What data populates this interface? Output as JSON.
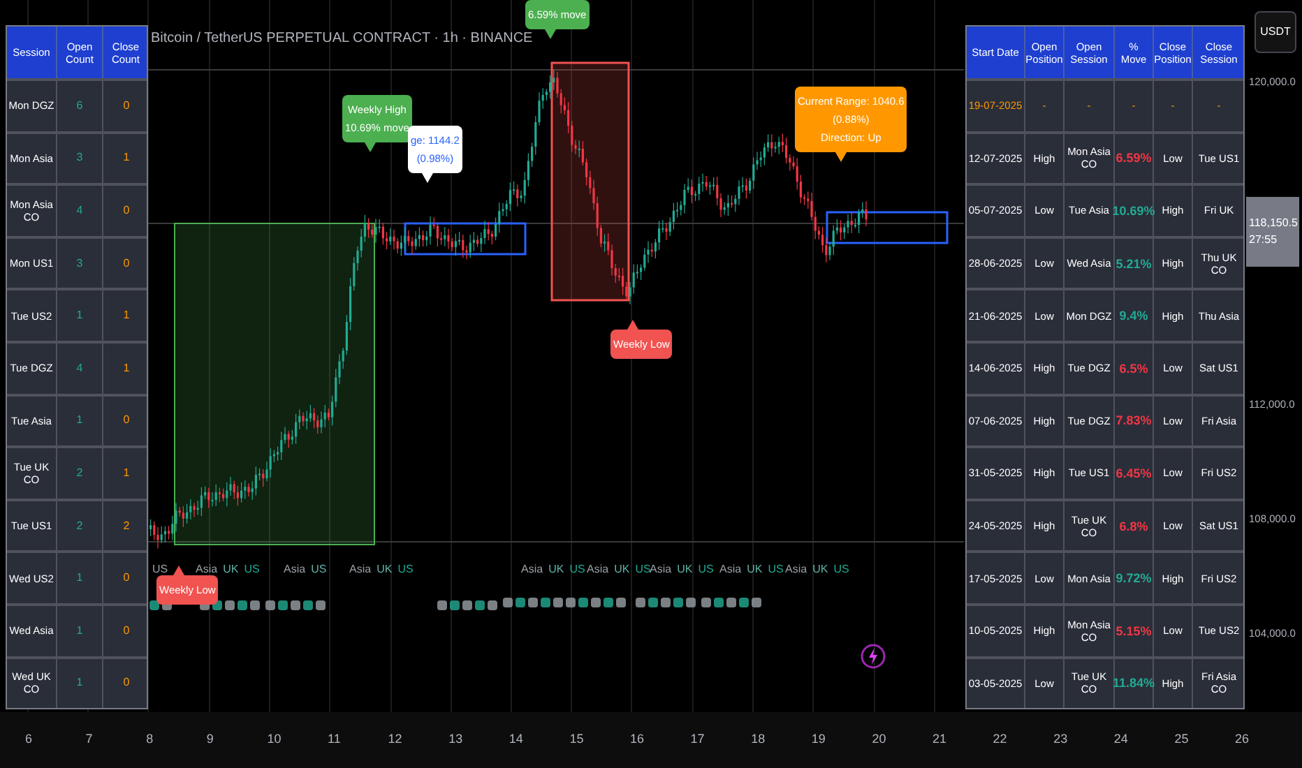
{
  "chart_title": "Bitcoin / TetherUS PERPETUAL CONTRACT · 1h · BINANCE",
  "session_table": {
    "columns": [
      "Session",
      "Open Count",
      "Close Count"
    ],
    "rows": [
      {
        "session": "Mon DGZ",
        "open_count": "6",
        "close_count": "0"
      },
      {
        "session": "Mon Asia",
        "open_count": "3",
        "close_count": "1"
      },
      {
        "session": "Mon Asia CO",
        "open_count": "4",
        "close_count": "0"
      },
      {
        "session": "Mon US1",
        "open_count": "3",
        "close_count": "0"
      },
      {
        "session": "Tue US2",
        "open_count": "1",
        "close_count": "1"
      },
      {
        "session": "Tue DGZ",
        "open_count": "4",
        "close_count": "1"
      },
      {
        "session": "Tue Asia",
        "open_count": "1",
        "close_count": "0"
      },
      {
        "session": "Tue UK CO",
        "open_count": "2",
        "close_count": "1"
      },
      {
        "session": "Tue US1",
        "open_count": "2",
        "close_count": "2"
      },
      {
        "session": "Wed US2",
        "open_count": "1",
        "close_count": "0"
      },
      {
        "session": "Wed Asia",
        "open_count": "1",
        "close_count": "0"
      },
      {
        "session": "Wed UK CO",
        "open_count": "1",
        "close_count": "0"
      }
    ]
  },
  "chart_labels": [
    {
      "kind": "high",
      "lines": [
        "Weekly High",
        "10.69% move"
      ]
    },
    {
      "kind": "range",
      "lines": [
        "ge: 1144.2",
        "(0.98%)"
      ]
    },
    {
      "kind": "high",
      "lines": [
        "6.59% move"
      ]
    },
    {
      "kind": "low",
      "lines": [
        "Weekly Low"
      ]
    },
    {
      "kind": "low",
      "lines": [
        "Weekly Low"
      ]
    },
    {
      "kind": "current",
      "lines": [
        "Current Range: 1040.6",
        "(0.88%)",
        "Direction: Up"
      ]
    }
  ],
  "session_markers": [
    {
      "items": [
        "US"
      ]
    },
    {
      "items": [
        "Asia",
        "UK",
        "US"
      ]
    },
    {
      "items": [
        "Asia",
        "US"
      ]
    },
    {
      "items": [
        "Asia",
        "UK",
        "US"
      ]
    },
    {
      "items": [
        "Asia",
        "UK",
        "US"
      ]
    },
    {
      "items": [
        "Asia",
        "UK",
        "US"
      ]
    },
    {
      "items": [
        "Asia",
        "UK",
        "US"
      ]
    },
    {
      "items": [
        "Asia",
        "UK",
        "US"
      ]
    },
    {
      "items": [
        "Asia",
        "UK",
        "US"
      ]
    }
  ],
  "weekly_table": {
    "columns": [
      "Start Date",
      "Open Position",
      "Open Session",
      "% Move",
      "Close Position",
      "Close Session"
    ],
    "rows": [
      {
        "current": true,
        "cells": [
          "19-07-2025",
          "-",
          "-",
          "-",
          "-",
          "-"
        ]
      },
      {
        "current": false,
        "color": "#f23645",
        "cells": [
          "12-07-2025",
          "High",
          "Mon Asia CO",
          "6.59%",
          "Low",
          "Tue US1"
        ]
      },
      {
        "current": false,
        "color": "#22ab94",
        "cells": [
          "05-07-2025",
          "Low",
          "Tue Asia",
          "10.69%",
          "High",
          "Fri UK"
        ]
      },
      {
        "current": false,
        "color": "#22ab94",
        "cells": [
          "28-06-2025",
          "Low",
          "Wed Asia",
          "5.21%",
          "High",
          "Thu UK CO"
        ]
      },
      {
        "current": false,
        "color": "#22ab94",
        "cells": [
          "21-06-2025",
          "Low",
          "Mon DGZ",
          "9.4%",
          "High",
          "Thu Asia"
        ]
      },
      {
        "current": false,
        "color": "#f23645",
        "cells": [
          "14-06-2025",
          "High",
          "Tue DGZ",
          "6.5%",
          "Low",
          "Sat US1"
        ]
      },
      {
        "current": false,
        "color": "#f23645",
        "cells": [
          "07-06-2025",
          "High",
          "Tue DGZ",
          "7.83%",
          "Low",
          "Fri Asia"
        ]
      },
      {
        "current": false,
        "color": "#f23645",
        "cells": [
          "31-05-2025",
          "High",
          "Tue US1",
          "6.45%",
          "Low",
          "Fri US2"
        ]
      },
      {
        "current": false,
        "color": "#f23645",
        "cells": [
          "24-05-2025",
          "High",
          "Tue UK CO",
          "6.8%",
          "Low",
          "Sat US1"
        ]
      },
      {
        "current": false,
        "color": "#22ab94",
        "cells": [
          "17-05-2025",
          "Low",
          "Mon Asia",
          "9.72%",
          "High",
          "Fri US2"
        ]
      },
      {
        "current": false,
        "color": "#f23645",
        "cells": [
          "10-05-2025",
          "High",
          "Mon Asia CO",
          "5.15%",
          "Low",
          "Tue US2"
        ]
      },
      {
        "current": false,
        "color": "#22ab94",
        "cells": [
          "03-05-2025",
          "Low",
          "Tue UK CO",
          "11.84%",
          "High",
          "Fri Asia CO"
        ]
      }
    ]
  },
  "price_axis": {
    "currency": "USDT",
    "ticks": [
      "120,000.0",
      "112,000.0",
      "108,000.0",
      "104,000.0"
    ],
    "current_price": "118,150.5",
    "countdown": "27:55"
  },
  "time_axis": [
    "6",
    "7",
    "8",
    "9",
    "10",
    "11",
    "12",
    "13",
    "14",
    "15",
    "16",
    "17",
    "18",
    "19",
    "20",
    "21",
    "22",
    "23",
    "24",
    "25",
    "26"
  ]
}
